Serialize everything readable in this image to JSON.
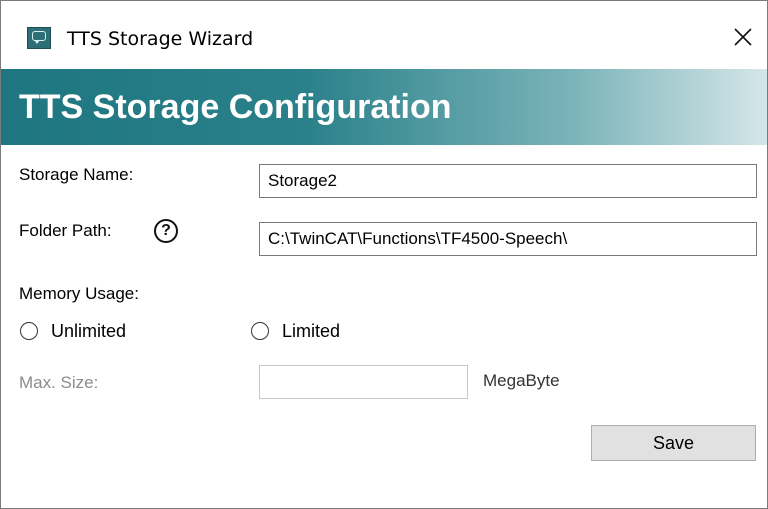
{
  "window": {
    "title": "TTS Storage Wizard",
    "close_glyph": "✕"
  },
  "banner": {
    "title": "TTS Storage Configuration",
    "gradient_start": "#1e7680",
    "gradient_end": "#d5e6e8"
  },
  "form": {
    "storage_name_label": "Storage Name:",
    "storage_name_value": "Storage2",
    "folder_path_label": "Folder Path:",
    "folder_path_help": "?",
    "folder_path_value": "C:\\TwinCAT\\Functions\\TF4500-Speech\\",
    "memory_usage_label": "Memory Usage:",
    "radio_unlimited": "Unlimited",
    "radio_limited": "Limited",
    "max_size_label": "Max. Size:",
    "max_size_value": "",
    "max_size_unit": "MegaByte",
    "save_label": "Save"
  },
  "icons": {
    "app": "speech-bubble-icon",
    "close": "close-icon",
    "help": "help-icon"
  }
}
